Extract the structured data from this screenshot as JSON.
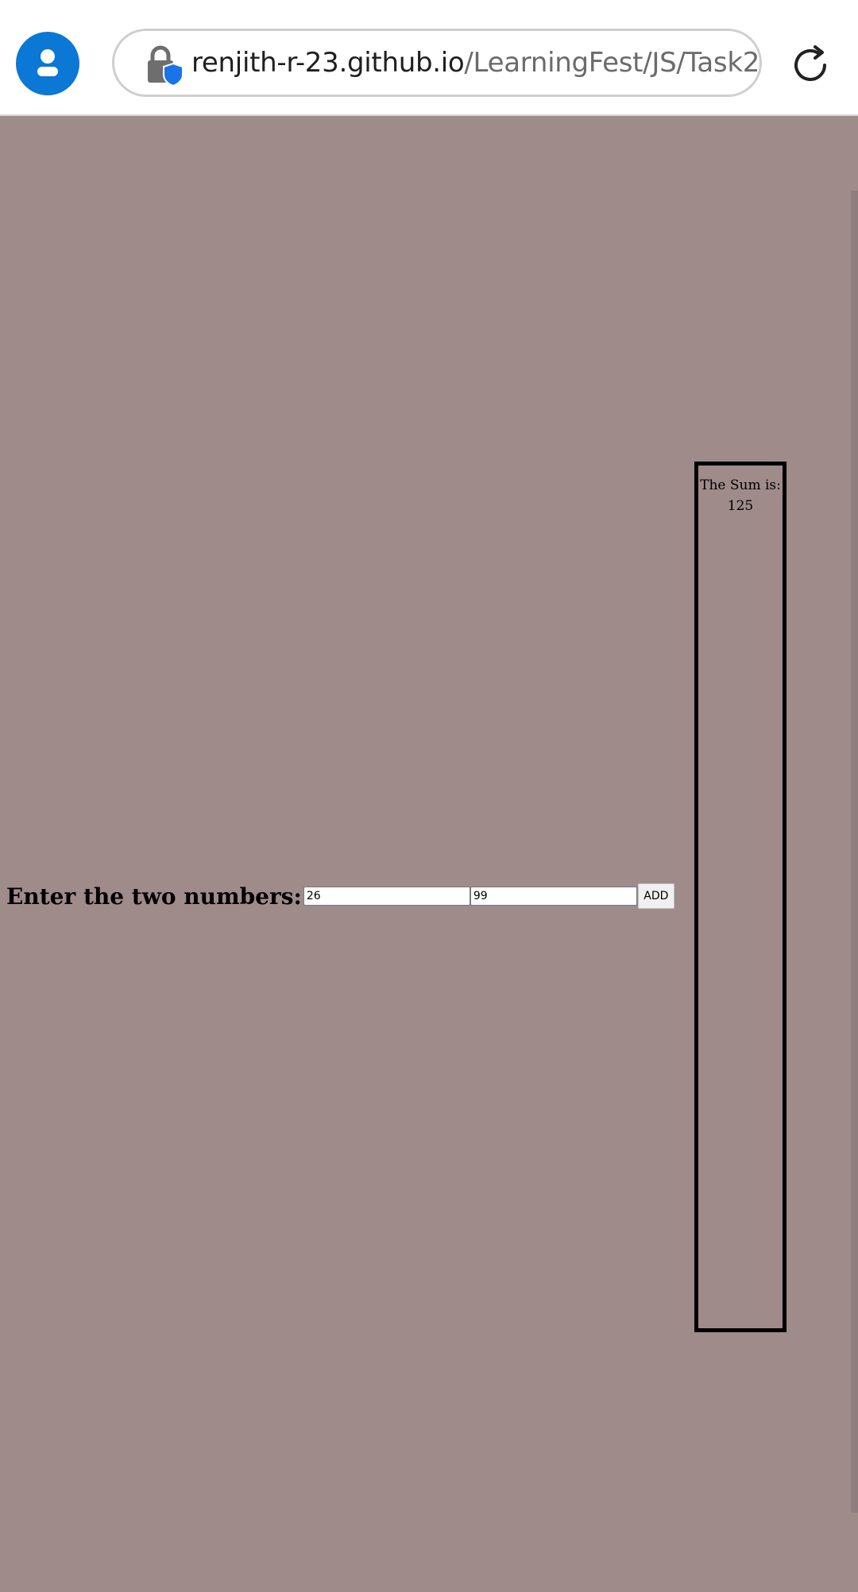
{
  "browser": {
    "url_host": "renjith-r-23.github.io",
    "url_path": "/LearningFest/JS/Task2/",
    "icons": {
      "profile": "profile-icon",
      "lock": "lock-shield-icon",
      "reload": "reload-icon"
    },
    "colors": {
      "profile_bg": "#0a78d4",
      "shield": "#1a73e8"
    }
  },
  "page": {
    "background": "#9f8b8a",
    "prompt_label": "Enter the two numbers:",
    "first_number": "26",
    "second_number": "99",
    "add_label": "ADD",
    "result_label": "The Sum is:",
    "result_value": "125"
  }
}
